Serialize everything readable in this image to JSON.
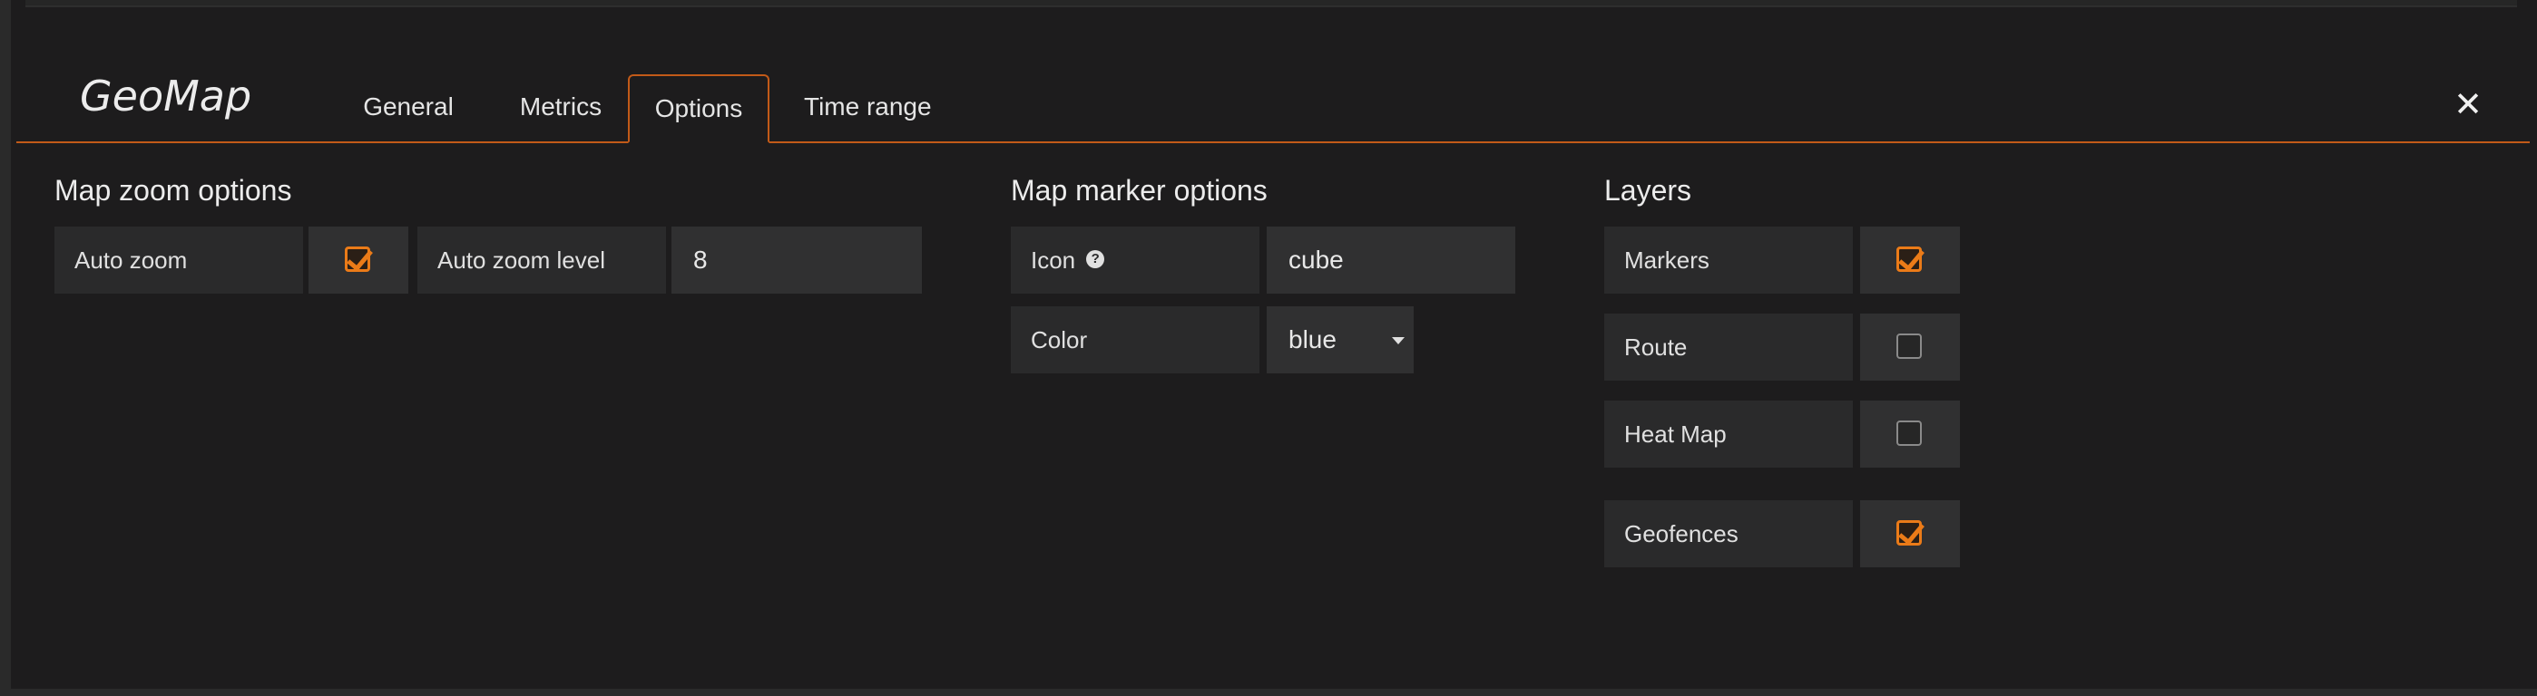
{
  "panel": {
    "title": "GeoMap"
  },
  "tabs": [
    {
      "label": "General",
      "active": false
    },
    {
      "label": "Metrics",
      "active": false
    },
    {
      "label": "Options",
      "active": true
    },
    {
      "label": "Time range",
      "active": false
    }
  ],
  "close": {
    "icon": "close-icon"
  },
  "zoom": {
    "title": "Map zoom options",
    "auto_zoom_label": "Auto zoom",
    "auto_zoom_checked": true,
    "auto_zoom_level_label": "Auto zoom level",
    "auto_zoom_level_value": "8"
  },
  "marker": {
    "title": "Map marker options",
    "icon_label": "Icon",
    "icon_value": "cube",
    "color_label": "Color",
    "color_value": "blue"
  },
  "layers": {
    "title": "Layers",
    "items": [
      {
        "label": "Markers",
        "checked": true
      },
      {
        "label": "Route",
        "checked": false
      },
      {
        "label": "Heat Map",
        "checked": false
      },
      {
        "label": "Geofences",
        "checked": true
      }
    ]
  },
  "colors": {
    "accent": "#eb7b18",
    "tab_border": "#c25a18",
    "background": "#1d1c1d",
    "label_bg": "#2a2a2b",
    "value_bg": "#303031"
  }
}
